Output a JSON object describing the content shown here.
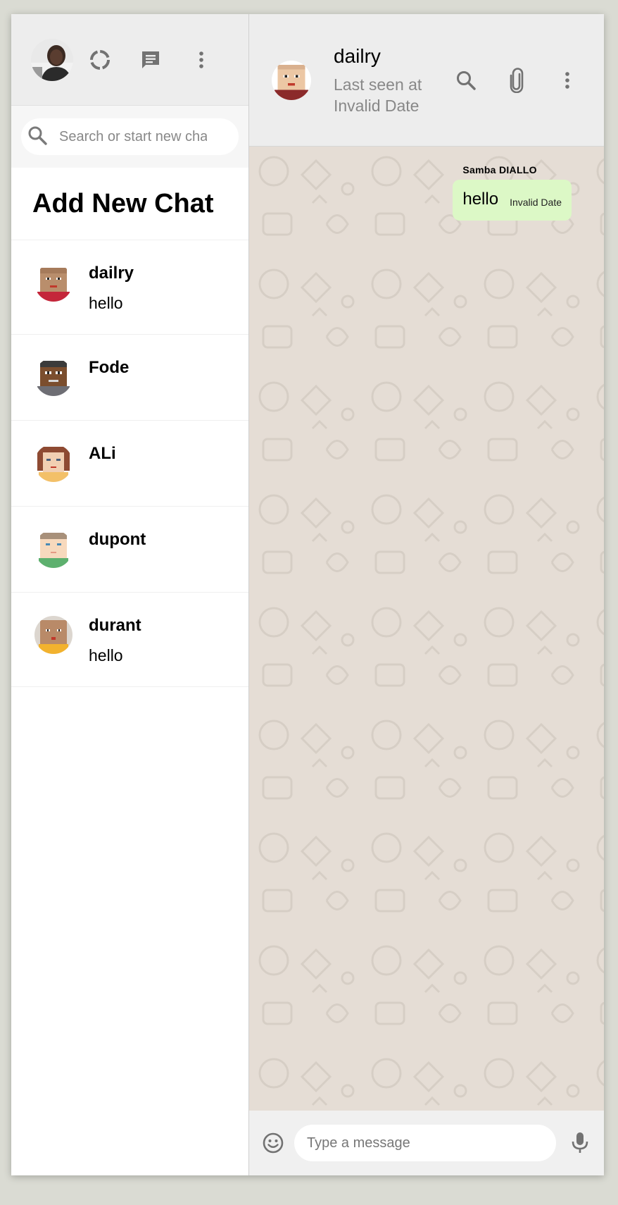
{
  "sidebar": {
    "search": {
      "placeholder": "Search or start new chat",
      "icon": "search-icon"
    },
    "add_chat_label": "Add New Chat",
    "header_icons": [
      "status-icon",
      "new-chat-icon",
      "menu-icon"
    ],
    "chats": [
      {
        "name": "dailry",
        "last_message": "hello"
      },
      {
        "name": "Fode",
        "last_message": ""
      },
      {
        "name": "ALi",
        "last_message": ""
      },
      {
        "name": "dupont",
        "last_message": ""
      },
      {
        "name": "durant",
        "last_message": "hello"
      }
    ]
  },
  "chat": {
    "header": {
      "name": "dailry",
      "status": "Last seen at Invalid Date",
      "icons": [
        "search-icon",
        "attach-icon",
        "menu-icon"
      ]
    },
    "messages": [
      {
        "sender": "Samba DIALLO",
        "text": "hello",
        "time": "Invalid Date"
      }
    ],
    "footer": {
      "placeholder": "Type a message",
      "icons": [
        "emoji-icon",
        "mic-icon"
      ]
    }
  },
  "colors": {
    "header_bg": "#ededed",
    "chat_bg": "#e5ddd5",
    "sent_bubble": "#dcf8c6",
    "icon_gray": "#757575"
  }
}
